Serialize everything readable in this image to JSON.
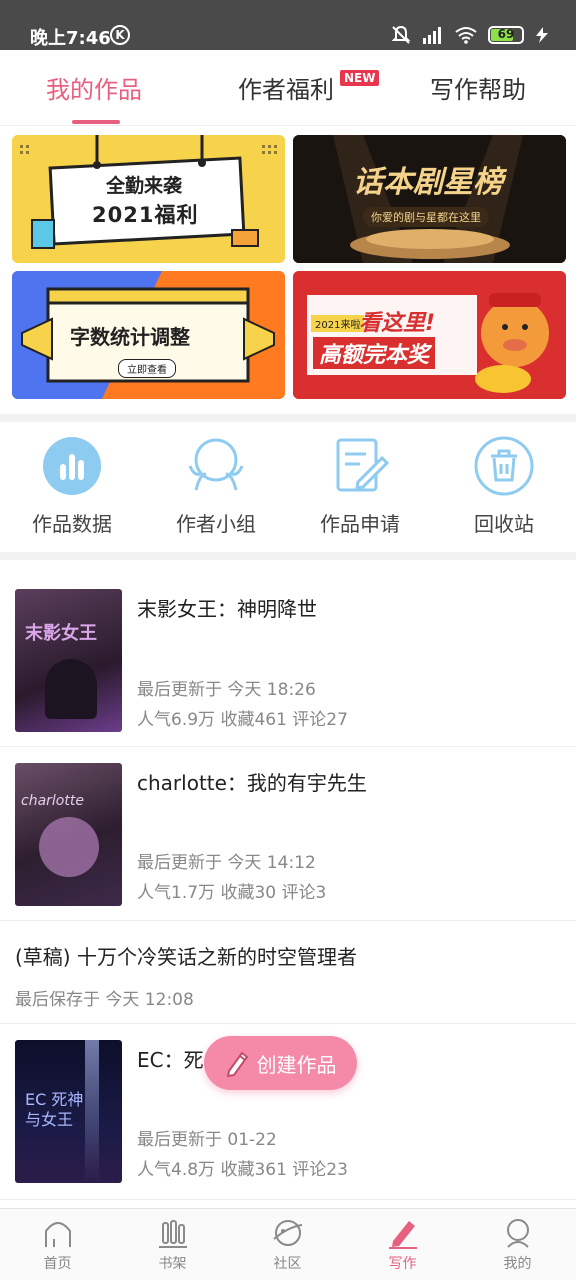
{
  "status_bar": {
    "time": "晚上7:46",
    "k_label": "K",
    "battery": "69"
  },
  "tabs": [
    {
      "label": "我的作品",
      "active": true
    },
    {
      "label": "作者福利",
      "badge": "NEW"
    },
    {
      "label": "写作帮助"
    }
  ],
  "banners": {
    "b1_line1": "全勤来袭",
    "b1_line2": "2021福利",
    "b2_title": "话本剧星榜",
    "b2_sub": "你爱的剧与星都在这里",
    "b3_title": "字数统计调整",
    "b3_button": "立即查看",
    "b4_tag": "2021来啦",
    "b4_line1": "看这里!",
    "b4_line2": "高额完本奖"
  },
  "shortcuts": [
    {
      "label": "作品数据",
      "icon": "bar-chart-icon"
    },
    {
      "label": "作者小组",
      "icon": "group-icon"
    },
    {
      "label": "作品申请",
      "icon": "edit-document-icon"
    },
    {
      "label": "回收站",
      "icon": "trash-icon"
    }
  ],
  "works": [
    {
      "title": "末影女王：神明降世",
      "updated": "最后更新于 今天 18:26",
      "stats": "人气6.9万  收藏461  评论27",
      "cover_text": "末影女王"
    },
    {
      "title": "charlotte：我的有宇先生",
      "updated": "最后更新于 今天 14:12",
      "stats": "人气1.7万  收藏30  评论3",
      "cover_text": "charlotte"
    },
    {
      "title": "(草稿) 十万个冷笑话之新的时空管理者",
      "updated": "最后保存于 今天 12:08"
    },
    {
      "title": "EC：死",
      "updated": "最后更新于 01-22",
      "stats": "人气4.8万  收藏361  评论23",
      "cover_text": "EC 死神 与女王"
    }
  ],
  "create_button": "创建作品",
  "bottom_nav": [
    {
      "label": "首页",
      "icon": "home-icon"
    },
    {
      "label": "书架",
      "icon": "bookshelf-icon"
    },
    {
      "label": "社区",
      "icon": "planet-icon"
    },
    {
      "label": "写作",
      "icon": "pen-icon",
      "active": true
    },
    {
      "label": "我的",
      "icon": "profile-icon"
    }
  ],
  "colors": {
    "accent": "#e8607f",
    "icon_blue": "#8ecbf0",
    "create_pink": "#f48aa7"
  }
}
